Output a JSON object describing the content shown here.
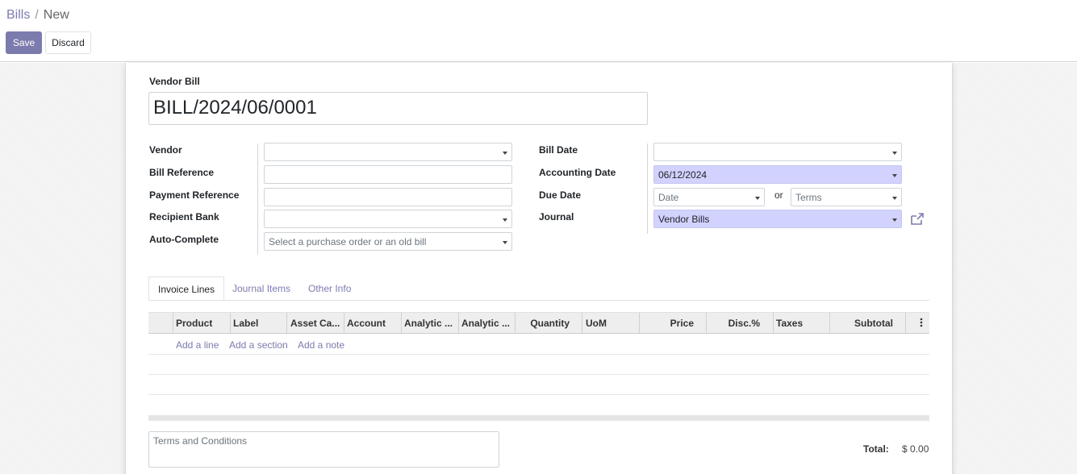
{
  "breadcrumb": {
    "parent": "Bills",
    "separator": "/",
    "current": "New"
  },
  "toolbar": {
    "save_label": "Save",
    "discard_label": "Discard"
  },
  "form": {
    "title_label": "Vendor Bill",
    "title_value": "BILL/2024/06/0001",
    "left_fields": [
      {
        "label": "Vendor",
        "value": ""
      },
      {
        "label": "Bill Reference",
        "value": ""
      },
      {
        "label": "Payment Reference",
        "value": ""
      },
      {
        "label": "Recipient Bank",
        "value": ""
      },
      {
        "label": "Auto-Complete",
        "placeholder": "Select a purchase order or an old bill"
      }
    ],
    "right_fields": {
      "bill_date": {
        "label": "Bill Date",
        "value": ""
      },
      "accounting_date": {
        "label": "Accounting Date",
        "value": "06/12/2024"
      },
      "due_date": {
        "label": "Due Date",
        "date_placeholder": "Date",
        "or_text": "or",
        "terms_placeholder": "Terms"
      },
      "journal": {
        "label": "Journal",
        "value": "Vendor Bills"
      }
    }
  },
  "tabs": [
    {
      "label": "Invoice Lines",
      "active": true
    },
    {
      "label": "Journal Items",
      "active": false
    },
    {
      "label": "Other Info",
      "active": false
    }
  ],
  "table": {
    "columns": [
      "Product",
      "Label",
      "Asset Ca...",
      "Account",
      "Analytic ...",
      "Analytic ...",
      "Quantity",
      "UoM",
      "Price",
      "Disc.%",
      "Taxes",
      "Subtotal"
    ],
    "add_links": [
      "Add a line",
      "Add a section",
      "Add a note"
    ]
  },
  "footer": {
    "terms_placeholder": "Terms and Conditions",
    "total_label": "Total:",
    "total_value": "$ 0.00"
  },
  "colors": {
    "accent": "#7c7bad",
    "highlight_field": "#d2d2ff"
  },
  "icons": [
    "external-link-icon",
    "caret-down-icon",
    "kebab-menu-icon"
  ]
}
